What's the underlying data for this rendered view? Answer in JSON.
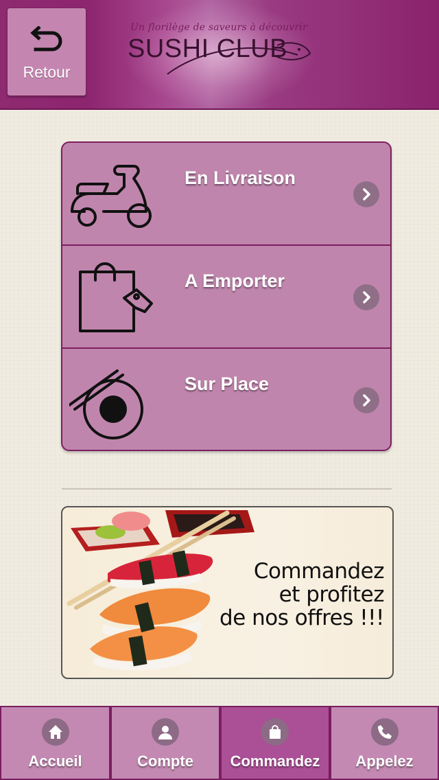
{
  "header": {
    "back_label": "Retour",
    "logo_tagline": "Un florilège de saveurs à découvrir",
    "logo_brand": "SUSHI CLUB"
  },
  "menu": {
    "items": [
      {
        "label": "En Livraison",
        "icon": "scooter-icon"
      },
      {
        "label": "A Emporter",
        "icon": "shopping-bag-icon"
      },
      {
        "label": "Sur Place",
        "icon": "plate-chopsticks-icon"
      }
    ]
  },
  "promo": {
    "line1": "Commandez",
    "line2": "et profitez",
    "line3": "de nos offres !!!"
  },
  "bottom_nav": {
    "items": [
      {
        "label": "Accueil",
        "icon": "home-icon",
        "active": false
      },
      {
        "label": "Compte",
        "icon": "user-icon",
        "active": false
      },
      {
        "label": "Commandez",
        "icon": "bag-icon",
        "active": true
      },
      {
        "label": "Appelez",
        "icon": "phone-icon",
        "active": false
      }
    ]
  },
  "colors": {
    "brand": "#8e2a70",
    "menu_bg": "#c085ad",
    "nav_active": "#ab4f96"
  }
}
